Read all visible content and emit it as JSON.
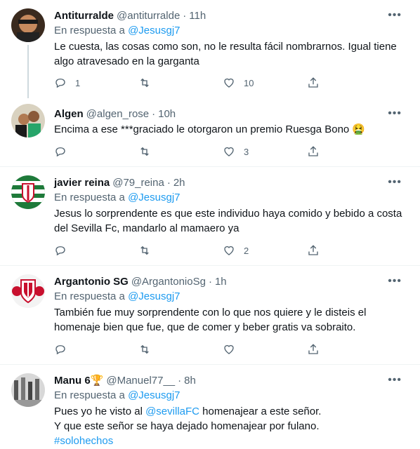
{
  "reply_prefix": "En respuesta a",
  "tweets": [
    {
      "name": "Antiturralde",
      "handle": "@antiturralde",
      "time": "11h",
      "reply_to": "@Jesusgj7",
      "text": "Le cuesta, las cosas como son, no le resulta fácil nombrarnos. Igual tiene algo atravesado en la garganta",
      "replies": "1",
      "retweets": "",
      "likes": "10"
    },
    {
      "name": "Algen",
      "handle": "@algen_rose",
      "time": "10h",
      "text": "Encima a ese ***graciado le otorgaron un premio Ruesga Bono 🤮",
      "replies": "",
      "retweets": "",
      "likes": "3"
    },
    {
      "name": "javier reina",
      "handle": "@79_reina",
      "time": "2h",
      "reply_to": "@Jesusgj7",
      "text": "Jesus lo sorprendente es que este individuo haya comido y bebido a costa del Sevilla Fc, mandarlo al mamaero ya",
      "replies": "",
      "retweets": "",
      "likes": "2"
    },
    {
      "name": "Argantonio SG",
      "handle": "@ArgantonioSg",
      "time": "1h",
      "reply_to": "@Jesusgj7",
      "text": "También fue muy sorprendente con lo que nos quiere y le disteis el homenaje bien que fue, que de comer y beber gratis va sobraito.",
      "replies": "",
      "retweets": "",
      "likes": ""
    },
    {
      "name": "Manu 6🏆",
      "handle": "@Manuel77__",
      "time": "8h",
      "reply_to": "@Jesusgj7",
      "text_line1_pre": "Pues yo he visto al ",
      "text_line1_mention": "@sevillaFC",
      "text_line1_post": " homenajear a este señor.",
      "text_line2": "Y que este señor se haya dejado homenajear por fulano.",
      "text_line3": "#solohechos"
    }
  ],
  "icons": [
    "reply-icon",
    "retweet-icon",
    "like-icon",
    "share-icon",
    "more-icon"
  ]
}
